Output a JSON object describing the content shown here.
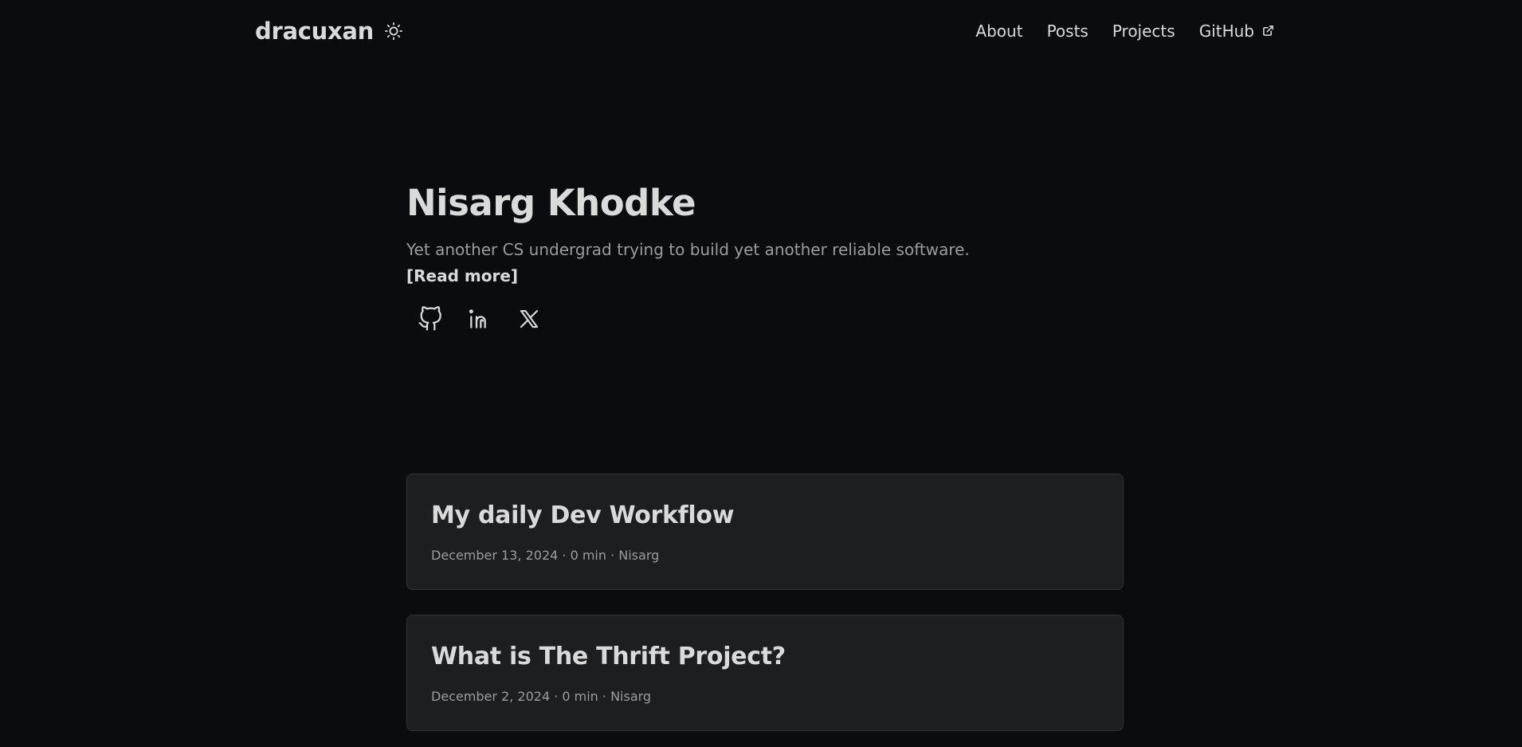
{
  "header": {
    "logo": "dracuxan",
    "theme_toggle_icon": "sun-icon",
    "nav": [
      {
        "label": "About"
      },
      {
        "label": "Posts"
      },
      {
        "label": "Projects"
      },
      {
        "label": "GitHub",
        "icon": "external-link-icon"
      }
    ]
  },
  "intro": {
    "name": "Nisarg Khodke",
    "tagline": "Yet another CS undergrad trying to build yet another reliable software.",
    "read_more": "[Read more]",
    "socials": [
      {
        "icon": "github-icon"
      },
      {
        "icon": "linkedin-icon"
      },
      {
        "icon": "x-twitter-icon"
      }
    ]
  },
  "posts": [
    {
      "title": "My daily Dev Workflow",
      "meta": "December 13, 2024 · 0 min · Nisarg"
    },
    {
      "title": "What is The Thrift Project?",
      "meta": "December 2, 2024 · 0 min · Nisarg"
    }
  ],
  "colors": {
    "background": "#0b0c0f",
    "card": "#1d1e20",
    "primary_text": "#dadadb",
    "secondary_text": "#9b9c9d"
  }
}
